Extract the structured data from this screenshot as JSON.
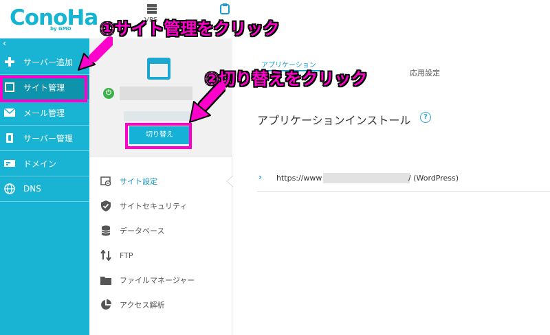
{
  "header": {
    "logo": "ConoHa",
    "logo_sub": "by GMO",
    "vps_label": "VPS",
    "icons": [
      "server-icon",
      "app-icon"
    ]
  },
  "sidebar": {
    "collapse_label": "‹",
    "items": [
      {
        "label": "サーバー追加",
        "icon": "plus-icon"
      },
      {
        "label": "サイト管理",
        "icon": "window-icon",
        "active": true
      },
      {
        "label": "メール管理",
        "icon": "mail-icon"
      },
      {
        "label": "サーバー管理",
        "icon": "server-icon"
      },
      {
        "label": "ドメイン",
        "icon": "domain-icon"
      },
      {
        "label": "DNS",
        "icon": "globe-icon"
      }
    ]
  },
  "panel": {
    "switch_button": "切り替え",
    "menu": [
      {
        "label": "サイト設定",
        "icon": "settings-icon",
        "active": true
      },
      {
        "label": "サイトセキュリティ",
        "icon": "shield-icon"
      },
      {
        "label": "データベース",
        "icon": "database-icon"
      },
      {
        "label": "FTP",
        "icon": "transfer-icon"
      },
      {
        "label": "ファイルマネージャー",
        "icon": "folder-icon"
      },
      {
        "label": "アクセス解析",
        "icon": "pie-chart-icon"
      }
    ]
  },
  "main": {
    "tab_app": "アプリケーション",
    "tab_setting": "応用設定",
    "section_title": "アプリケーションインストール",
    "help_icon": "?",
    "row_arrow": "›",
    "url_prefix": "https://www",
    "url_suffix": "/ (WordPress)"
  },
  "annotations": {
    "step1": "①サイト管理をクリック",
    "step2": "②切り替えをクリック"
  },
  "colors": {
    "sidebar": "#19b4d3",
    "accent": "#1b9cd0",
    "annotation": "#ff00cc",
    "button": "#15b1d6"
  }
}
